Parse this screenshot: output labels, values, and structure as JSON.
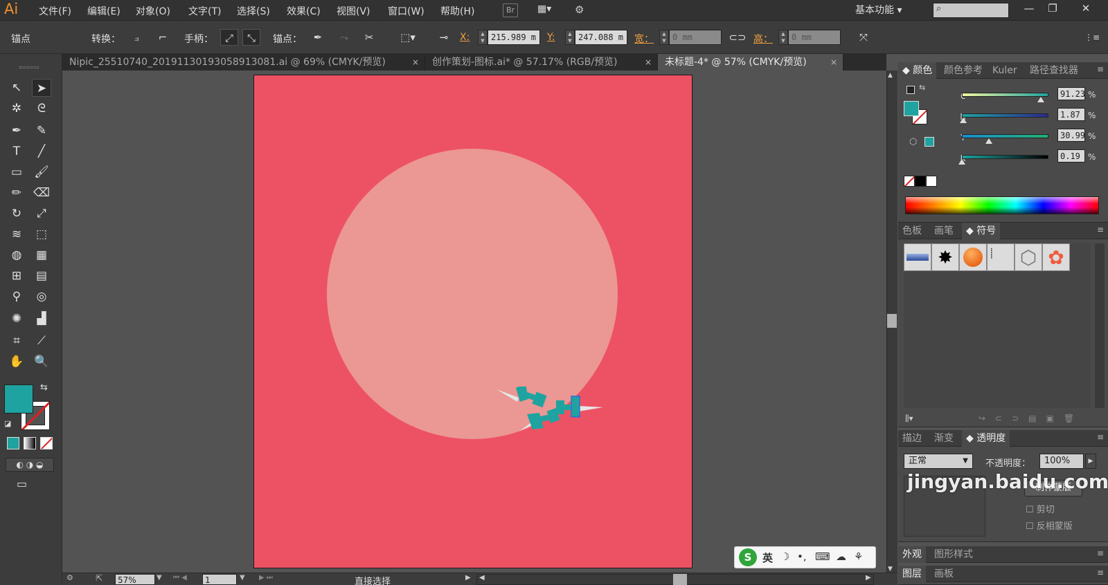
{
  "app": {
    "logo": "Ai"
  },
  "menu": [
    "文件(F)",
    "编辑(E)",
    "对象(O)",
    "文字(T)",
    "选择(S)",
    "效果(C)",
    "视图(V)",
    "窗口(W)",
    "帮助(H)"
  ],
  "menubar": {
    "bridge_label": "Br",
    "workspace": "基本功能",
    "minimize": "—",
    "restore": "❐",
    "close": "✕"
  },
  "control": {
    "mode": "锚点",
    "convert_label": "转换：",
    "handle_label": "手柄：",
    "anchor_label": "锚点：",
    "x_label": "X:",
    "x_value": "215.989 m",
    "y_label": "Y:",
    "y_value": "247.088 m",
    "width_label": "宽：",
    "width_value": "0 mm",
    "height_label": "高：",
    "height_value": "0 mm"
  },
  "tabs": [
    {
      "label": "Nipic_25510740_20191130193058913081.ai @ 69% (CMYK/预览)",
      "close": "×"
    },
    {
      "label": "创作策划-图标.ai* @ 57.17% (RGB/预览)",
      "close": "×"
    },
    {
      "label": "未标题-4* @ 57% (CMYK/预览)",
      "close": "×"
    }
  ],
  "tools_colors": {
    "fill": "#1fa3a0",
    "stroke": "none"
  },
  "artboard": {
    "background": "#ed5264",
    "circle": "#eb9793",
    "pin_color": "#1fa3a0"
  },
  "status": {
    "zoom": "57%",
    "page": "1",
    "tool": "直接选择"
  },
  "color_panel": {
    "tabs": [
      "颜色",
      "颜色参考",
      "Kuler",
      "路径查找器"
    ],
    "sliders": [
      {
        "label": "C",
        "value": "91.23",
        "pct": "%",
        "amount": 0.9123
      },
      {
        "label": "M",
        "value": "1.87",
        "pct": "%",
        "amount": 0.0187
      },
      {
        "label": "Y",
        "value": "30.99",
        "pct": "%",
        "amount": 0.3099
      },
      {
        "label": "K",
        "value": "0.19",
        "pct": "%",
        "amount": 0.0019
      }
    ]
  },
  "symbols_panel": {
    "tabs": [
      "色板",
      "画笔",
      "符号"
    ]
  },
  "transparency_panel": {
    "tabs": [
      "描边",
      "渐变",
      "透明度"
    ],
    "blend_mode": "正常",
    "opacity_label": "不透明度：",
    "opacity_value": "100%",
    "make_mask": "制作蒙版",
    "clip": "剪切",
    "invert": "反相蒙版"
  },
  "appearance_panel": {
    "tabs": [
      "外观",
      "图形样式"
    ]
  },
  "layers_panel": {
    "tabs": [
      "图层",
      "画板"
    ]
  },
  "ime": {
    "logo": "S",
    "lang": "英"
  },
  "watermark": {
    "text": "jingyan.baidu.com"
  }
}
